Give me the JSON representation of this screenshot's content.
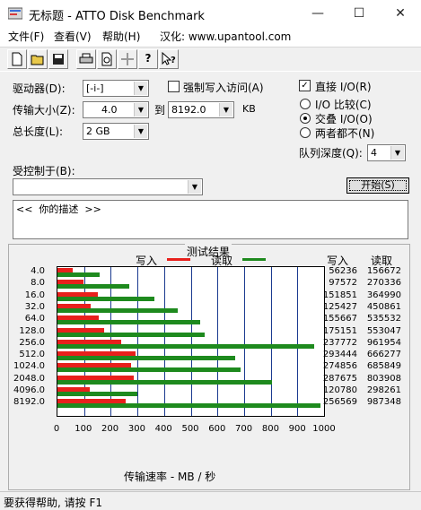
{
  "window": {
    "title": "无标题 - ATTO Disk Benchmark",
    "minimize": "—",
    "maximize": "☐",
    "close": "✕"
  },
  "menu": [
    "文件(F)",
    "查看(V)",
    "帮助(H)",
    "汉化: www.upantool.com"
  ],
  "toolbar": [
    "new-doc-icon",
    "open-folder-icon",
    "save-icon",
    "print-icon",
    "print-preview-icon",
    "move-icon",
    "help-icon",
    "context-help-icon"
  ],
  "form": {
    "drive_label": "驱动器(D):",
    "drive_value": "[-i-]",
    "force_write_label": "强制写入访问(A)",
    "force_write_checked": false,
    "direct_io_label": "直接 I/O(R)",
    "direct_io_checked": true,
    "transfer_label": "传输大小(Z):",
    "transfer_from": "4.0",
    "to_label": "到",
    "transfer_to": "8192.0",
    "kb_label": "KB",
    "length_label": "总长度(L):",
    "length_value": "2 GB",
    "io_compare_label": "I/O 比较(C)",
    "overlapped_io_label": "交叠 I/O(O)",
    "neither_label": "两者都不(N)",
    "io_mode_selected": "交叠 I/O(O)",
    "queue_label": "队列深度(Q):",
    "queue_value": "4",
    "controlled_by_label": "受控制于(B):",
    "controlled_by_value": "",
    "start_button": "开始(S)",
    "description": "<<  你的描述  >>"
  },
  "results": {
    "group_title": "测试结果",
    "write_legend": "写入",
    "read_legend": "读取",
    "write_color": "#e8201c",
    "read_color": "#1e8a1e",
    "grid_color": "#1a3a8f",
    "write_header": "写入",
    "read_header": "读取",
    "xlabel": "传输速率 - MB / 秒"
  },
  "chart_data": {
    "type": "bar",
    "orientation": "horizontal",
    "categories": [
      "4.0",
      "8.0",
      "16.0",
      "32.0",
      "64.0",
      "128.0",
      "256.0",
      "512.0",
      "1024.0",
      "2048.0",
      "4096.0",
      "8192.0"
    ],
    "series": [
      {
        "name": "写入",
        "values": [
          56236,
          97572,
          151851,
          125427,
          155667,
          175151,
          237772,
          293444,
          274856,
          287675,
          120780,
          256569
        ]
      },
      {
        "name": "读取",
        "values": [
          156672,
          270336,
          364990,
          450861,
          535532,
          553047,
          961954,
          666277,
          685849,
          803908,
          298261,
          987348
        ]
      }
    ],
    "xlabel": "传输速率 - MB / 秒",
    "xlim": [
      0,
      1000
    ],
    "xticks": [
      "0",
      "100",
      "200",
      "300",
      "400",
      "500",
      "600",
      "700",
      "800",
      "900",
      "1000"
    ],
    "grid": true
  },
  "status": {
    "text": "要获得帮助, 请按 F1"
  }
}
